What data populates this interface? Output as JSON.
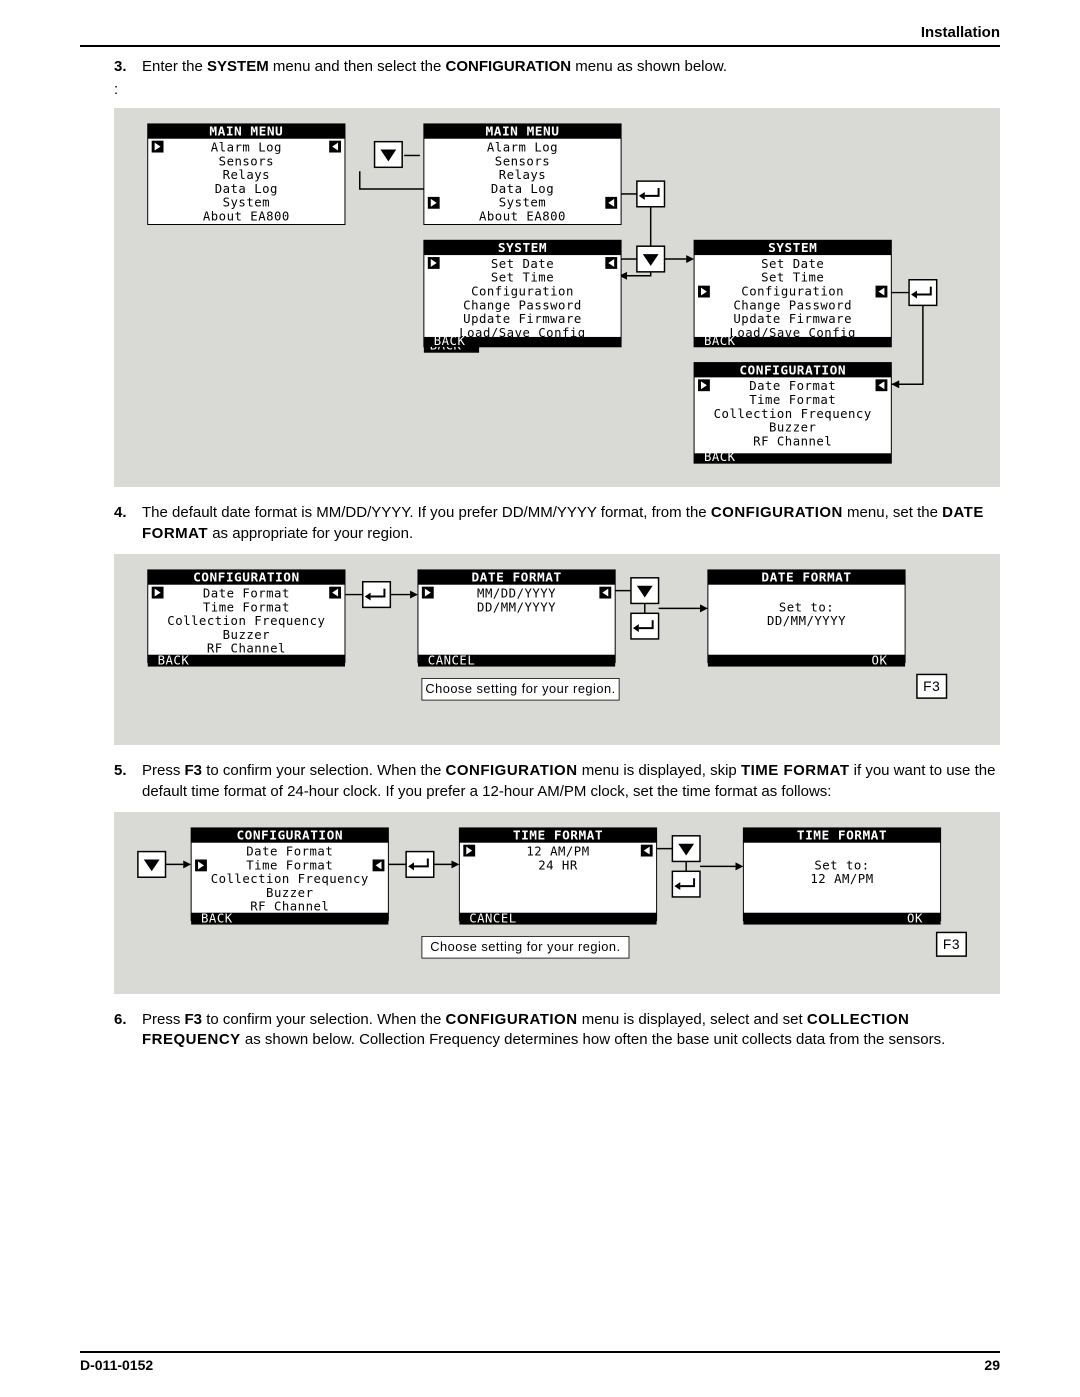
{
  "header": {
    "section": "Installation"
  },
  "footer": {
    "doc_id": "D-011-0152",
    "page": "29"
  },
  "steps": {
    "s3": {
      "num": "3.",
      "pre": "Enter the ",
      "b1": "SYSTEM",
      "mid": " menu and then select the ",
      "b2": "CONFIGURATION",
      "post": " menu as shown below."
    },
    "s4": {
      "num": "4.",
      "pre": "The default date format is MM/DD/YYYY. If you prefer DD/MM/YYYY format, from the ",
      "b1": "CONFIGURATION",
      "mid": " menu, set the ",
      "b2": "DATE FORMAT",
      "post": " as appropriate for your region."
    },
    "s5": {
      "num": "5.",
      "pre": "Press ",
      "b1": "F3",
      "mid1": " to confirm your selection. When the ",
      "b2": "CONFIGURATION",
      "mid2": " menu is displayed, skip ",
      "b3": "TIME FORMAT",
      "post": " if you want to use the default time format of 24-hour clock. If you prefer a 12-hour AM/PM clock, set the time format as follows:"
    },
    "s6": {
      "num": "6.",
      "pre": "Press ",
      "b1": "F3",
      "mid1": " to confirm your selection. When the ",
      "b2": "CONFIGURATION",
      "mid2": " menu is displayed, select and set ",
      "b3": "COLLECTION FREQUENCY",
      "post": " as shown below. Collection Frequency determines how often the base unit collects data from the sensors."
    }
  },
  "labels": {
    "back": "BACK",
    "cancel": "CANCEL",
    "ok": "OK",
    "f3": "F3",
    "choose_region": "Choose setting for your region."
  },
  "screens": {
    "main_menu": {
      "title": "MAIN MENU",
      "items": [
        "Alarm Log",
        "Sensors",
        "Relays",
        "Data Log",
        "System",
        "About EA800"
      ]
    },
    "system": {
      "title": "SYSTEM",
      "items": [
        "Set Date",
        "Set Time",
        "Configuration",
        "Change Password",
        "Update Firmware",
        "Load/Save Config"
      ]
    },
    "configuration": {
      "title": "CONFIGURATION",
      "items": [
        "Date Format",
        "Time Format",
        "Collection Frequency",
        "Buzzer",
        "RF Channel"
      ]
    },
    "date_format_opts": {
      "title": "DATE FORMAT",
      "items": [
        "MM/DD/YYYY",
        "DD/MM/YYYY"
      ]
    },
    "date_format_set": {
      "title": "DATE FORMAT",
      "line1": "Set to:",
      "line2": "DD/MM/YYYY"
    },
    "time_format_opts": {
      "title": "TIME FORMAT",
      "items": [
        "12 AM/PM",
        "24 HR"
      ]
    },
    "time_format_set": {
      "title": "TIME FORMAT",
      "line1": "Set to:",
      "line2": "12 AM/PM"
    }
  }
}
